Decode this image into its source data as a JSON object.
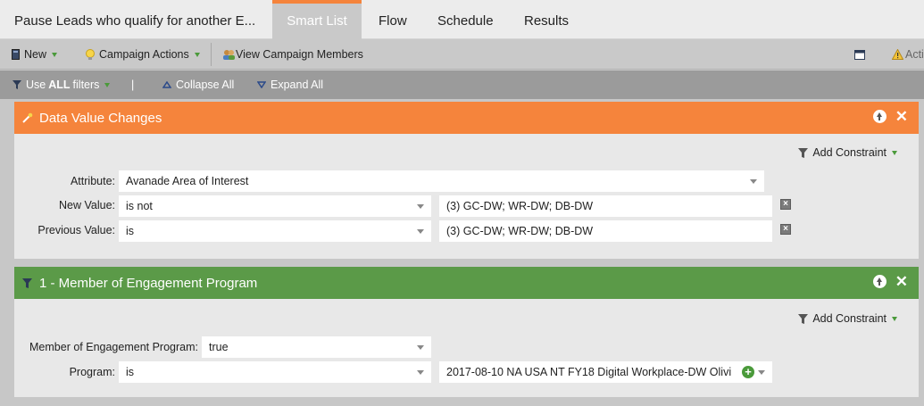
{
  "tabs": {
    "title": "Pause Leads who qualify for another E...",
    "smart_list": "Smart List",
    "flow": "Flow",
    "schedule": "Schedule",
    "results": "Results"
  },
  "toolbar": {
    "new": "New",
    "campaign_actions": "Campaign Actions",
    "view_members": "View Campaign Members",
    "actions_cut": "Acti"
  },
  "filterbar": {
    "use_prefix": "Use",
    "use_all": "ALL",
    "use_suffix": "filters",
    "divider": "|",
    "collapse_all": "Collapse All",
    "expand_all": "Expand All"
  },
  "filter1": {
    "title": "Data Value Changes",
    "color": "#f5843c",
    "add_constraint": "Add Constraint",
    "attribute_label": "Attribute:",
    "attribute_value": "Avanade Area of Interest",
    "new_value_label": "New Value:",
    "new_value_operator": "is not",
    "new_value_value": "(3) GC-DW; WR-DW; DB-DW",
    "prev_value_label": "Previous Value:",
    "prev_value_operator": "is",
    "prev_value_value": "(3) GC-DW; WR-DW; DB-DW"
  },
  "filter2": {
    "title": "1 - Member of Engagement Program",
    "color": "#5b9a48",
    "add_constraint": "Add Constraint",
    "member_label": "Member of Engagement Program:",
    "member_value": "true",
    "program_label": "Program:",
    "program_operator": "is",
    "program_value": "2017-08-10 NA USA NT FY18 Digital Workplace-DW Olivi"
  }
}
